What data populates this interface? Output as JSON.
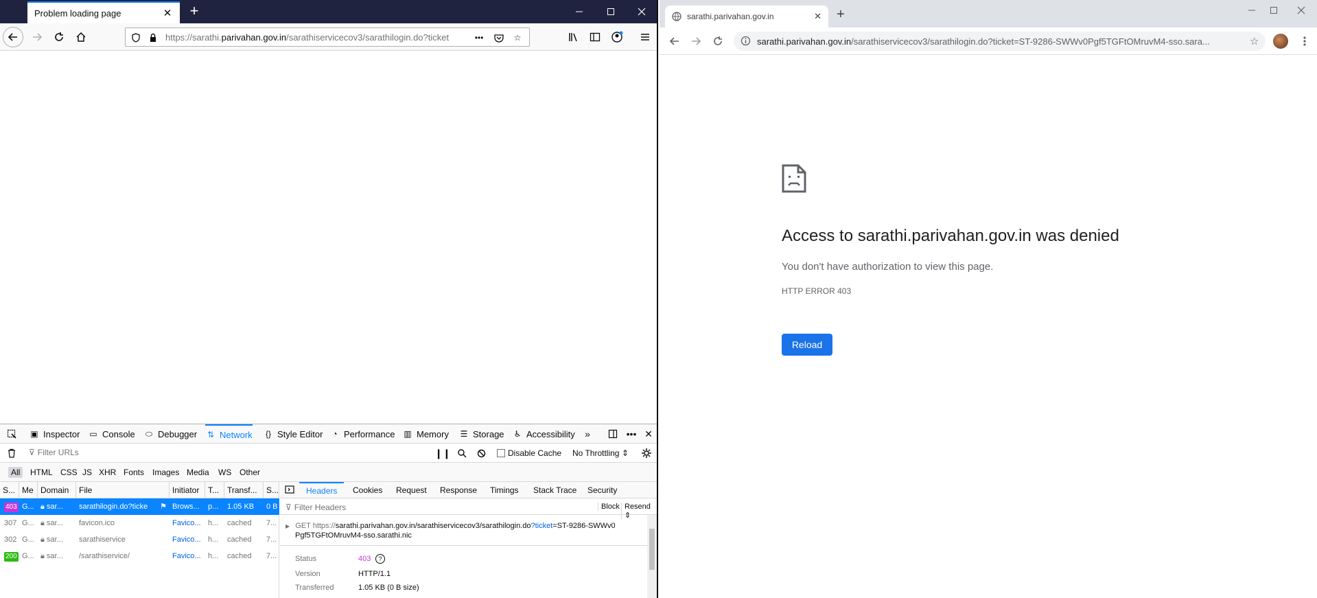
{
  "firefox": {
    "tab_title": "Problem loading page",
    "url_prefix": "https://sarathi.",
    "url_domain": "parivahan.gov.in",
    "url_rest": "/sarathiservicecov3/sarathilogin.do?ticket",
    "devtools": {
      "tabs": [
        "Inspector",
        "Console",
        "Debugger",
        "Network",
        "Style Editor",
        "Performance",
        "Memory",
        "Storage",
        "Accessibility"
      ],
      "active_tab": "Network",
      "filter_placeholder": "Filter URLs",
      "disable_cache_label": "Disable Cache",
      "throttling": "No Throttling ⇕",
      "types": [
        "All",
        "HTML",
        "CSS",
        "JS",
        "XHR",
        "Fonts",
        "Images",
        "Media",
        "WS",
        "Other"
      ],
      "columns": [
        "S...",
        "Me",
        "Domain",
        "File",
        "Initiator",
        "T...",
        "Transf...",
        "S..."
      ],
      "rows": [
        {
          "status": "403",
          "method": "G...",
          "domain": "sar...",
          "file": "sarathilogin.do?ticke",
          "initiator": "Brows...",
          "type": "p...",
          "transferred": "1.05 KB",
          "size": "0 B"
        },
        {
          "status": "307",
          "method": "G...",
          "domain": "sar...",
          "file": "favicon.ico",
          "initiator": "Favico...",
          "type": "h...",
          "transferred": "cached",
          "size": "7..."
        },
        {
          "status": "302",
          "method": "G...",
          "domain": "sar...",
          "file": "sarathiservice",
          "initiator": "Favico...",
          "type": "h...",
          "transferred": "cached",
          "size": "7..."
        },
        {
          "status": "200",
          "method": "G...",
          "domain": "sar...",
          "file": "/sarathiservice/",
          "initiator": "Favico...",
          "type": "h...",
          "transferred": "cached",
          "size": "7..."
        }
      ],
      "detail_tabs": [
        "Headers",
        "Cookies",
        "Request",
        "Response",
        "Timings",
        "Stack Trace",
        "Security"
      ],
      "detail_active": "Headers",
      "filter_headers_placeholder": "Filter Headers",
      "block_label": "Block",
      "resend_label": "Resend ⇕",
      "request_method": "GET",
      "request_url_a": "https://",
      "request_url_domain": "sarathi.parivahan.gov.in",
      "request_url_path": "/sarathiservicecov3/sarathilogin.do",
      "request_url_param": "?ticket",
      "request_url_value": "=ST-9286-SWWv0",
      "request_url_line2": "Pgf5TGFtOMruvM4-sso.sarathi.nic",
      "status_label": "Status",
      "status_value": "403",
      "version_label": "Version",
      "version_value": "HTTP/1.1",
      "transferred_label": "Transferred",
      "transferred_value": "1.05 KB (0 B size)"
    }
  },
  "chrome": {
    "tab_title": "sarathi.parivahan.gov.in",
    "url_domain": "sarathi.parivahan.gov.in",
    "url_rest": "/sarathiservicecov3/sarathilogin.do?ticket=ST-9286-SWWv0Pgf5TGFtOMruvM4-sso.sara...",
    "error_title": "Access to sarathi.parivahan.gov.in was denied",
    "error_desc": "You don't have authorization to view this page.",
    "error_code": "HTTP ERROR 403",
    "reload_label": "Reload"
  },
  "colors": {
    "ff_accent": "#0a84ff",
    "status_403": "#c836d9",
    "status_200": "#2cbb0f",
    "chrome_button": "#1a73e8"
  }
}
